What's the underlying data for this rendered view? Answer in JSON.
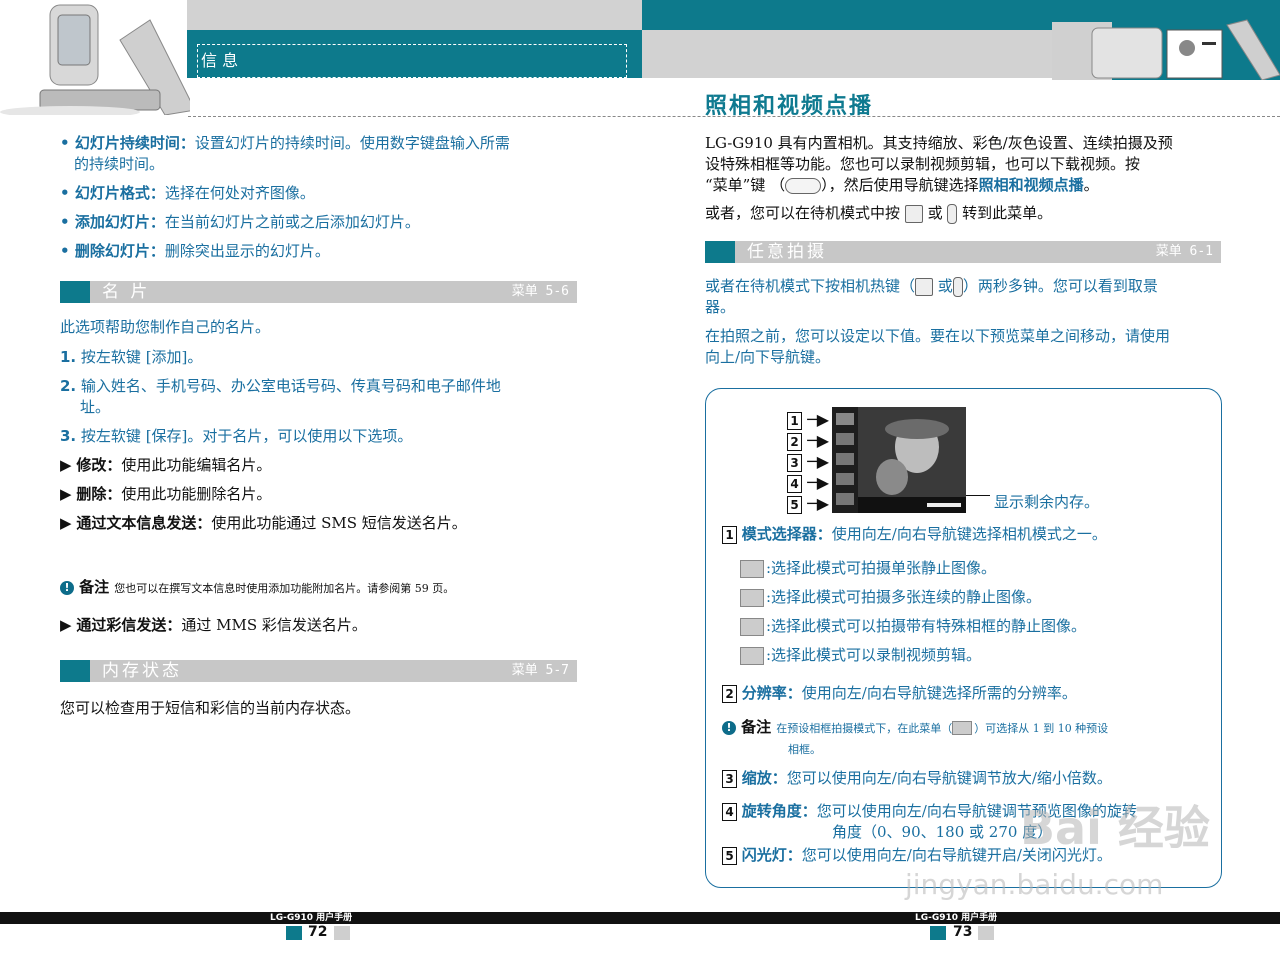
{
  "header": {
    "left_title": "信 息",
    "right_title": "照相和视频点播"
  },
  "left": {
    "bullets": [
      {
        "term": "幻灯片持续时间：",
        "text": "设置幻灯片的持续时间。使用数字键盘输入所需的持续时间。",
        "line1": "设置幻灯片的持续时间。使用数字键盘输入所需",
        "line2": "的持续时间。"
      },
      {
        "term": "幻灯片格式：",
        "text": "选择在何处对齐图像。"
      },
      {
        "term": "添加幻灯片：",
        "text": "在当前幻灯片之前或之后添加幻灯片。"
      },
      {
        "term": "删除幻灯片：",
        "text": "删除突出显示的幻灯片。"
      }
    ],
    "section1": {
      "title": "名 片",
      "menu": "菜单 5-6"
    },
    "s1_intro": "此选项帮助您制作自己的名片。",
    "steps": [
      {
        "num": "1.",
        "text": "按左软键 [添加]。"
      },
      {
        "num": "2.",
        "line1": "输入姓名、手机号码、办公室电话号码、传真号码和电子邮件地",
        "line2": "址。"
      },
      {
        "num": "3.",
        "text": "按左软键 [保存]。对于名片，可以使用以下选项。"
      }
    ],
    "options": [
      {
        "term": "修改：",
        "text": "使用此功能编辑名片。"
      },
      {
        "term": "删除：",
        "text": "使用此功能删除名片。"
      },
      {
        "term": "通过文本信息发送：",
        "text": "使用此功能通过 SMS 短信发送名片。"
      }
    ],
    "note_label": "备注",
    "note_text": "您也可以在撰写文本信息时使用添加功能附加名片。请参阅第 59 页。",
    "mms": {
      "term": "通过彩信发送：",
      "text": "通过 MMS 彩信发送名片。"
    },
    "section2": {
      "title": "内存状态",
      "menu": "菜单 5-7"
    },
    "s2_text": "您可以检查用于短信和彩信的当前内存状态。"
  },
  "right": {
    "intro_l1": "LG-G910 具有内置相机。其支持缩放、彩色/灰色设置、连续拍摄及预",
    "intro_l2": "设特殊相框等功能。您也可以录制视频剪辑，也可以下载视频。按",
    "intro_l3a": "“菜单”键 （",
    "intro_l3b": "），然后使用导航键选择",
    "intro_l3c": "照相和视频点播",
    "intro_l3d": "。",
    "alt_a": "或者，您可以在待机模式中按",
    "alt_b": "或",
    "alt_c": "转到此菜单。",
    "section": {
      "title": "任意拍摄",
      "menu": "菜单 6-1"
    },
    "p1a": "或者在待机模式下按相机热键（",
    "p1b": "或",
    "p1c": "）两秒多钟。您可以看到取景",
    "p1d": "器。",
    "p2_l1": "在拍照之前，您可以设定以下值。要在以下预览菜单之间移动，请使用",
    "p2_l2": "向上/向下导航键。",
    "callouts": [
      "1",
      "2",
      "3",
      "4",
      "5"
    ],
    "memory_label": "显示剩余内存。",
    "items": [
      {
        "num": "1",
        "term": "模式选择器：",
        "text": "使用向左/向右导航键选择相机模式之一。"
      },
      {
        "num": "2",
        "term": "分辨率：",
        "text": "使用向左/向右导航键选择所需的分辨率。"
      },
      {
        "num": "3",
        "term": "缩放：",
        "text": "您可以使用向左/向右导航键调节放大/缩小倍数。"
      },
      {
        "num": "4",
        "term": "旋转角度：",
        "line1": "您可以使用向左/向右导航键调节预览图像的旋转",
        "line2": "角度（0、90、180 或 270 度）"
      },
      {
        "num": "5",
        "term": "闪光灯：",
        "text": "您可以使用向左/向右导航键开启/关闭闪光灯。"
      }
    ],
    "modes": [
      ":选择此模式可拍摄单张静止图像。",
      ":选择此模式可拍摄多张连续的静止图像。",
      ":选择此模式可以拍摄带有特殊相框的静止图像。",
      ":选择此模式可以录制视频剪辑。"
    ],
    "note_label": "备注",
    "note_l1a": "在预设相框拍摄模式下，在此菜单（",
    "note_l1b": "）可选择从 1 到 10 种预设",
    "note_l2": "相框。"
  },
  "footer": {
    "left_manual": "LG-G910 用户手册",
    "left_page": "72",
    "right_manual": "LG-G910 用户手册",
    "right_page": "73"
  },
  "watermark": {
    "line1": "Bai 经验",
    "line2": "jingyan.baidu.com"
  },
  "colors": {
    "accent_teal": "#0d7a8c",
    "text_blue": "#1a6fa0",
    "bar_gray": "#c7c7c7"
  },
  "icons": [
    "phone-image-icon",
    "camera-icon",
    "warning-icon",
    "menu-key-icon",
    "camera-hotkey-icon"
  ]
}
